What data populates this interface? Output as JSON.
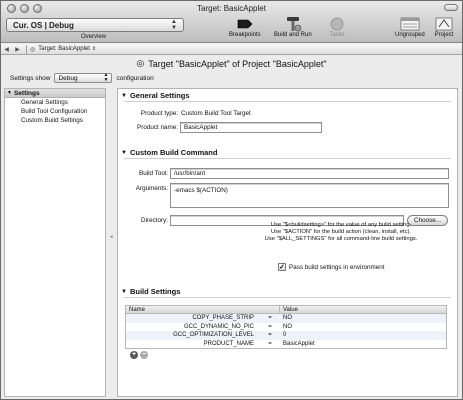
{
  "window": {
    "title": "Target: BasicApplet"
  },
  "toolbar": {
    "overview_value": "Cur. OS | Debug",
    "overview_label": "Overview",
    "breakpoints_label": "Breakpoints",
    "build_run_label": "Build and Run",
    "tasks_label": "Tasks",
    "ungrouped_label": "Ungrouped",
    "project_label": "Project"
  },
  "pathbar": {
    "crumb": "Target: BasicApplet"
  },
  "heading": "Target \"BasicApplet\" of Project \"BasicApplet\"",
  "settings_show": {
    "label": "Settings show",
    "value": "Debug",
    "suffix": "configuration"
  },
  "sidebar": {
    "header": "Settings",
    "items": [
      {
        "label": "General Settings"
      },
      {
        "label": "Build Tool Configuration"
      },
      {
        "label": "Custom Build Settings"
      }
    ]
  },
  "general": {
    "title": "General Settings",
    "product_type_label": "Product type:",
    "product_type_value": "Custom Build Tool Target",
    "product_name_label": "Product name:",
    "product_name_value": "BasicApplet"
  },
  "custom_build": {
    "title": "Custom Build Command",
    "build_tool_label": "Build Tool:",
    "build_tool_value": "/usr/bin/ant",
    "arguments_label": "Arguments:",
    "arguments_value": "-emacs $(ACTION)",
    "directory_label": "Directory:",
    "directory_value": "",
    "choose_label": "Choose...",
    "help_line1": "Use \"$<buildsetting>\" for the value of any build setting.",
    "help_line2": "Use \"$ACTION\" for the build action (clean, install, etc).",
    "help_line3": "Use \"$ALL_SETTINGS\" for all command-line build settings.",
    "pass_settings_label": "Pass build settings in environment",
    "pass_settings_checked": true
  },
  "build_settings": {
    "title": "Build Settings",
    "columns": [
      "Name",
      "Value"
    ],
    "rows": [
      {
        "name": "COPY_PHASE_STRIP",
        "eq": "=",
        "value": "NO"
      },
      {
        "name": "GCC_DYNAMIC_NO_PIC",
        "eq": "=",
        "value": "NO"
      },
      {
        "name": "GCC_OPTIMIZATION_LEVEL",
        "eq": "=",
        "value": "0"
      },
      {
        "name": "PRODUCT_NAME",
        "eq": "=",
        "value": "BasicApplet"
      }
    ]
  }
}
